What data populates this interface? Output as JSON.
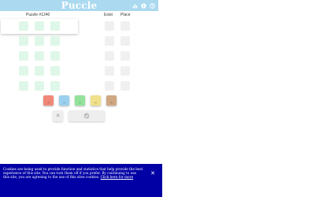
{
  "header": {
    "title": "Puccle",
    "icons": [
      "stats-icon",
      "info-icon",
      "help-icon"
    ]
  },
  "board": {
    "puzzle_label": "Puzzle #1240",
    "exist_label": "Exist",
    "place_label": "Place",
    "rows": 5,
    "columns": 3
  },
  "palette": {
    "colors": [
      "#f08877",
      "#9bd0ee",
      "#94e39b",
      "#f0e08a",
      "#cfa882"
    ]
  },
  "colors": {
    "header_bg": "#aad9f0",
    "empty_cell": "#dff7e8",
    "feedback_cell": "#f0f0f0",
    "cookie_bg": "#0000a5"
  },
  "cookie": {
    "text": "Cookies are being used to provide function and statistics that help provide the best experience of this site. You can turn them off if you prefer. By continuing to use this site, you are agreeing to the use of this sites cookies.",
    "link": "Click here for more"
  }
}
